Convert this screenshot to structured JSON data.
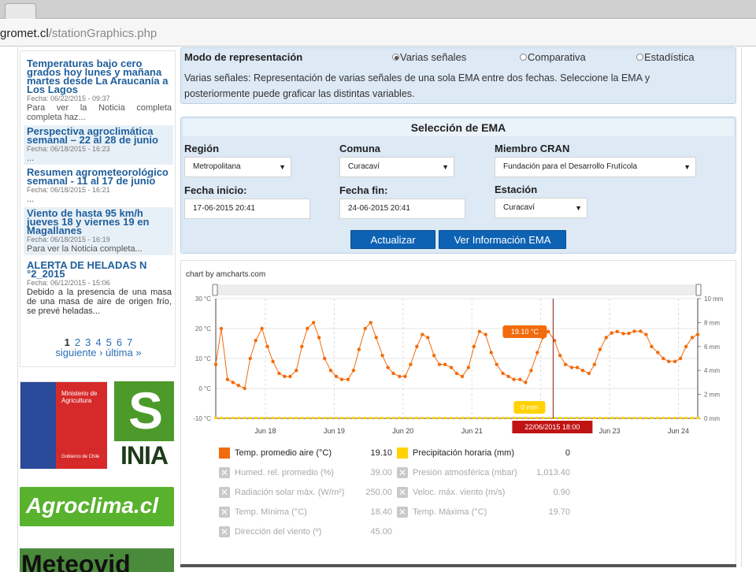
{
  "browser": {
    "url_host": "grom et.cl",
    "url_host_shown": "gromet.cl",
    "url_path": "/stationGraphics.php"
  },
  "news": [
    {
      "title": "Temperaturas bajo cero grados hoy lunes y mañana martes desde La Araucanía a Los Lagos",
      "date": "Fecha: 06/22/2015 - 09:37",
      "body": "Para ver la Noticia completa completa haz..."
    },
    {
      "title": "Perspectiva agroclimática semanal – 22 al 28 de junio",
      "date": "Fecha: 06/18/2015 - 16:23",
      "body": "..."
    },
    {
      "title": "Resumen agrometeorológico semanal - 11 al 17 de junio",
      "date": "Fecha: 06/18/2015 - 16:21",
      "body": "..."
    },
    {
      "title": "Viento de hasta 95 km/h jueves 18 y viernes 19 en Magallanes",
      "date": "Fecha: 06/18/2015 - 16:19",
      "body": "Para ver la Noticia completa..."
    },
    {
      "title": "ALERTA DE HELADAS N °2_2015",
      "date": "Fecha: 06/12/2015 - 15:06",
      "body": "Debido a la presencia de una masa de una masa de aire de origen frío, se prevé heladas..."
    }
  ],
  "pager": {
    "pages": [
      "1",
      "2",
      "3",
      "4",
      "5",
      "6",
      "7"
    ],
    "current": "1",
    "next": "siguiente ›",
    "last": "última »"
  },
  "logos": {
    "ministerio_l1": "Ministerio de",
    "ministerio_l2": "Agricultura",
    "gobierno": "Gobierno de Chile",
    "inia": "INIA",
    "agroclima": "Agroclima.cl",
    "meteovid": "Meteovid"
  },
  "modo": {
    "label": "Modo de representación",
    "options": [
      {
        "label": "Varias señales",
        "selected": true
      },
      {
        "label": "Comparativa",
        "selected": false
      },
      {
        "label": "Estadística",
        "selected": false
      }
    ],
    "description": "Varias señales: Representación de varias señales de una sola EMA entre dos fechas. Seleccione la EMA y posteriormente puede graficar las distintas variables."
  },
  "seleccion": {
    "title": "Selección de EMA",
    "region_label": "Región",
    "region_value": "Metropolitana",
    "comuna_label": "Comuna",
    "comuna_value": "Curacaví",
    "miembro_label": "Miembro CRAN",
    "miembro_value": "Fundación para el Desarrollo Frutícola",
    "fecha_inicio_label": "Fecha inicio:",
    "fecha_inicio_value": "17-06-2015 20:41",
    "fecha_fin_label": "Fecha fin:",
    "fecha_fin_value": "24-06-2015 20:41",
    "estacion_label": "Estación",
    "estacion_value": "Curacaví",
    "btn_actualizar": "Actualizar",
    "btn_info": "Ver Información EMA"
  },
  "chart_credit": "chart by amcharts.com",
  "chart_data": {
    "type": "line",
    "x_tick_labels": [
      "Jun 18",
      "Jun 19",
      "Jun 20",
      "Jun 21",
      "Jun 22",
      "Jun 23",
      "Jun 24"
    ],
    "y_left": {
      "ticks": [
        "30 °C",
        "20 °C",
        "10 °C",
        "0 °C",
        "-10 °C"
      ],
      "range": [
        -10,
        30
      ]
    },
    "y_right": {
      "ticks": [
        "10 mm",
        "8 mm",
        "6 mm",
        "4 mm",
        "2 mm",
        "0 mm"
      ],
      "range": [
        0,
        10
      ]
    },
    "cursor_label": "22/06/2015 18:00",
    "balloon_temp": "19.10 °C",
    "balloon_precip": "0 mm",
    "series": [
      {
        "name": "Temp. promedio aire (°C)",
        "color": "#f26b0c",
        "x_days": [
          0.0,
          0.08,
          0.17,
          0.25,
          0.33,
          0.42,
          0.5,
          0.58,
          0.67,
          0.75,
          0.83,
          0.92,
          1.0,
          1.08,
          1.17,
          1.25,
          1.33,
          1.42,
          1.5,
          1.58,
          1.67,
          1.75,
          1.83,
          1.92,
          2.0,
          2.08,
          2.17,
          2.25,
          2.33,
          2.42,
          2.5,
          2.58,
          2.67,
          2.75,
          2.83,
          2.92,
          3.0,
          3.08,
          3.17,
          3.25,
          3.33,
          3.42,
          3.5,
          3.58,
          3.67,
          3.75,
          3.83,
          3.92,
          4.0,
          4.08,
          4.17,
          4.25,
          4.33,
          4.42,
          4.5,
          4.58,
          4.67,
          4.75,
          4.83,
          4.92,
          5.0,
          5.08,
          5.17,
          5.25,
          5.33,
          5.42,
          5.5,
          5.58,
          5.67,
          5.75,
          5.83,
          5.92,
          6.0,
          6.08,
          6.17,
          6.25,
          6.33,
          6.42,
          6.5,
          6.58,
          6.67,
          6.75,
          6.83,
          6.92,
          7.0
        ],
        "values": [
          8,
          20,
          3,
          2,
          1,
          0,
          10,
          16,
          20,
          14,
          9,
          5,
          4,
          4,
          6,
          14,
          20,
          22,
          17,
          10,
          6,
          4,
          3,
          3,
          6,
          13,
          20,
          22,
          17,
          11,
          7,
          5,
          4,
          4,
          8,
          14,
          18,
          17,
          11,
          8,
          8,
          7,
          5,
          4,
          7,
          14,
          19,
          18,
          12,
          8,
          5,
          4,
          3,
          3,
          2,
          6,
          12,
          17,
          19,
          16,
          11,
          8,
          7,
          7,
          6,
          5,
          8,
          13,
          17,
          18.5,
          19,
          18.3,
          18.4,
          19.1,
          19.1,
          18,
          14,
          12,
          10,
          9,
          9,
          10,
          14,
          17,
          18
        ]
      },
      {
        "name": "Precipitación horaria (mm)",
        "color": "#ffd200",
        "value": "0"
      }
    ]
  },
  "legend": [
    {
      "name": "Temp. promedio aire (°C)",
      "value": "19.10",
      "color": "#f26b0c",
      "on": true
    },
    {
      "name": "Precipitación horaria (mm)",
      "value": "0",
      "color": "#ffd200",
      "on": true
    },
    {
      "name": "Humed. rel. promedio (%)",
      "value": "39.00",
      "on": false
    },
    {
      "name": "Presión atmosférica (mbar)",
      "value": "1,013.40",
      "on": false
    },
    {
      "name": "Radiación solar máx. (W/m²)",
      "value": "250.00",
      "on": false
    },
    {
      "name": "Veloc. máx. viento (m/s)",
      "value": "0.90",
      "on": false
    },
    {
      "name": "Temp. Mínima (°C)",
      "value": "18.40",
      "on": false
    },
    {
      "name": "Temp. Máxima (°C)",
      "value": "19.70",
      "on": false
    },
    {
      "name": "Dirección del viento (º)",
      "value": "45.00",
      "on": false
    }
  ]
}
